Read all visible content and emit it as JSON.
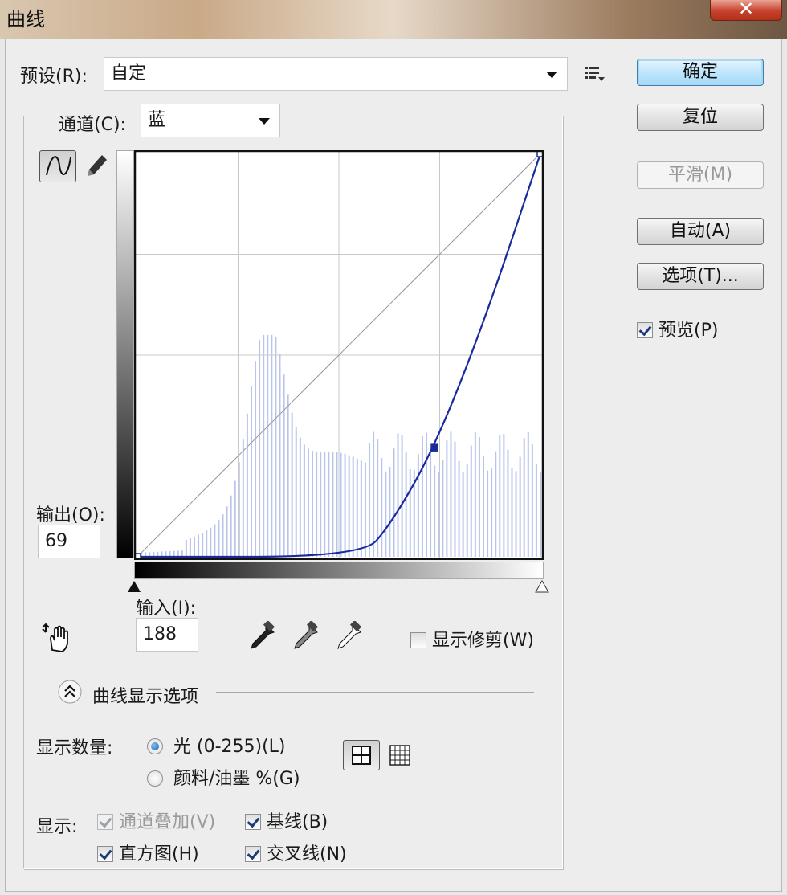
{
  "window": {
    "title": "曲线",
    "close_glyph": "✕"
  },
  "preset": {
    "label": "预设(R):",
    "value": "自定",
    "menu_icon": "list-menu-icon"
  },
  "channel": {
    "label": "通道(C):",
    "value": "蓝"
  },
  "buttons": {
    "ok": "确定",
    "reset": "复位",
    "smooth": "平滑(M)",
    "auto": "自动(A)",
    "options": "选项(T)..."
  },
  "preview": {
    "label": "预览(P)",
    "checked": true
  },
  "output": {
    "label": "输出(O):",
    "value": "69"
  },
  "input": {
    "label": "输入(I):",
    "value": "188"
  },
  "show_clipping": {
    "label": "显示修剪(W)",
    "checked": false
  },
  "curve_display_options": {
    "label": "曲线显示选项"
  },
  "show_amount": {
    "label": "显示数量:",
    "options": [
      {
        "label": "光 (0-255)(L)",
        "selected": true
      },
      {
        "label": "颜料/油墨 %(G)",
        "selected": false
      }
    ]
  },
  "show": {
    "label": "显示:",
    "channel_overlays": {
      "label": "通道叠加(V)",
      "checked": true,
      "disabled": true
    },
    "baseline": {
      "label": "基线(B)",
      "checked": true
    },
    "histogram": {
      "label": "直方图(H)",
      "checked": true
    },
    "intersection_line": {
      "label": "交叉线(N)",
      "checked": true
    }
  },
  "chart_data": {
    "type": "line",
    "xlim": [
      0,
      255
    ],
    "ylim": [
      0,
      255
    ],
    "grid": "4x4",
    "curve_points": [
      [
        0,
        0
      ],
      [
        188,
        69
      ],
      [
        255,
        255
      ]
    ],
    "curve_path": [
      [
        0,
        0
      ],
      [
        142,
        0
      ],
      [
        160,
        20
      ],
      [
        188,
        69
      ],
      [
        220,
        150
      ],
      [
        255,
        255
      ]
    ],
    "selected_point": [
      188,
      69
    ],
    "colors": {
      "curve": "#1a2a9a",
      "histogram": "#b8c4ea",
      "grid": "#c8c8c8",
      "diagonal": "#9a9a9a"
    }
  }
}
